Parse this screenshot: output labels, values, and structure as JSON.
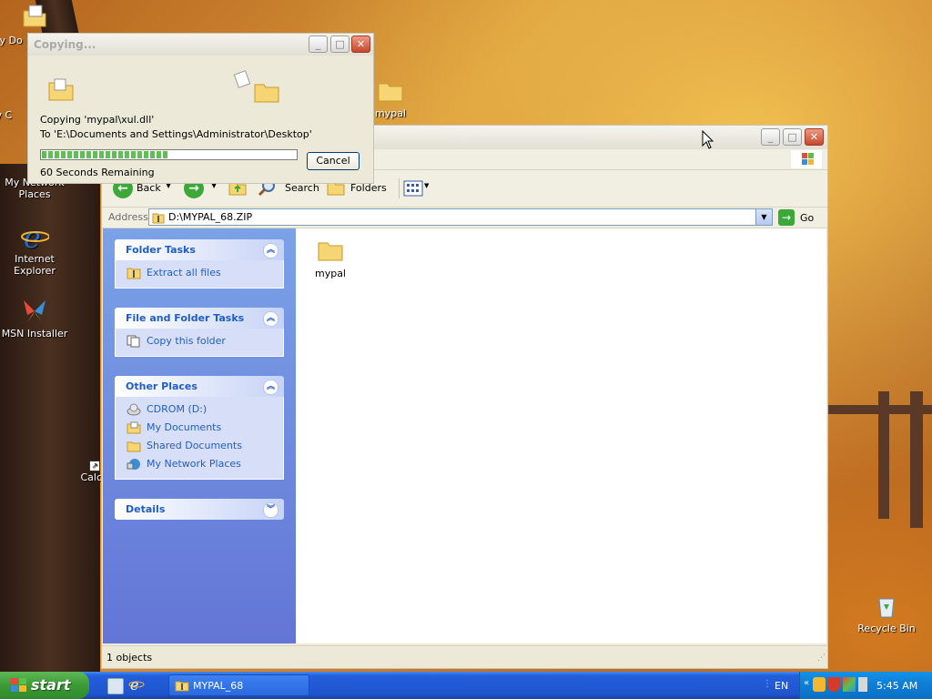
{
  "desktop": {
    "icons": [
      {
        "label": "My Do"
      },
      {
        "label": "My C"
      },
      {
        "label": "My Network Places"
      },
      {
        "label": "Internet Explorer"
      },
      {
        "label": "MSN Installer"
      },
      {
        "label": "mypal"
      },
      {
        "label": "Calc"
      },
      {
        "label": "Recycle Bin"
      }
    ]
  },
  "copy_dialog": {
    "title": "Copying...",
    "copying_line": "Copying 'mypal\\xul.dll'",
    "to_line": "To 'E:\\Documents and Settings\\Administrator\\Desktop'",
    "time_remaining": "60 Seconds Remaining",
    "cancel_label": "Cancel",
    "progress": 0.5
  },
  "explorer": {
    "toolbar": {
      "back_label": "Back",
      "search_label": "Search",
      "folders_label": "Folders"
    },
    "address": {
      "label": "Address",
      "value": "D:\\MYPAL_68.ZIP",
      "go_label": "Go"
    },
    "panels": [
      {
        "title": "Folder Tasks",
        "items": [
          "Extract all files"
        ]
      },
      {
        "title": "File and Folder Tasks",
        "items": [
          "Copy this folder"
        ]
      },
      {
        "title": "Other Places",
        "items": [
          "CDROM (D:)",
          "My Documents",
          "Shared Documents",
          "My Network Places"
        ]
      },
      {
        "title": "Details",
        "items": []
      }
    ],
    "files": [
      {
        "name": "mypal"
      }
    ],
    "status": "1 objects"
  },
  "taskbar": {
    "start_label": "start",
    "task_label": "MYPAL_68",
    "lang": "EN",
    "clock": "5:45 AM"
  },
  "colors": {
    "accent": "#215dc6",
    "taskbar": "#245edb",
    "start": "#3c9a36"
  }
}
